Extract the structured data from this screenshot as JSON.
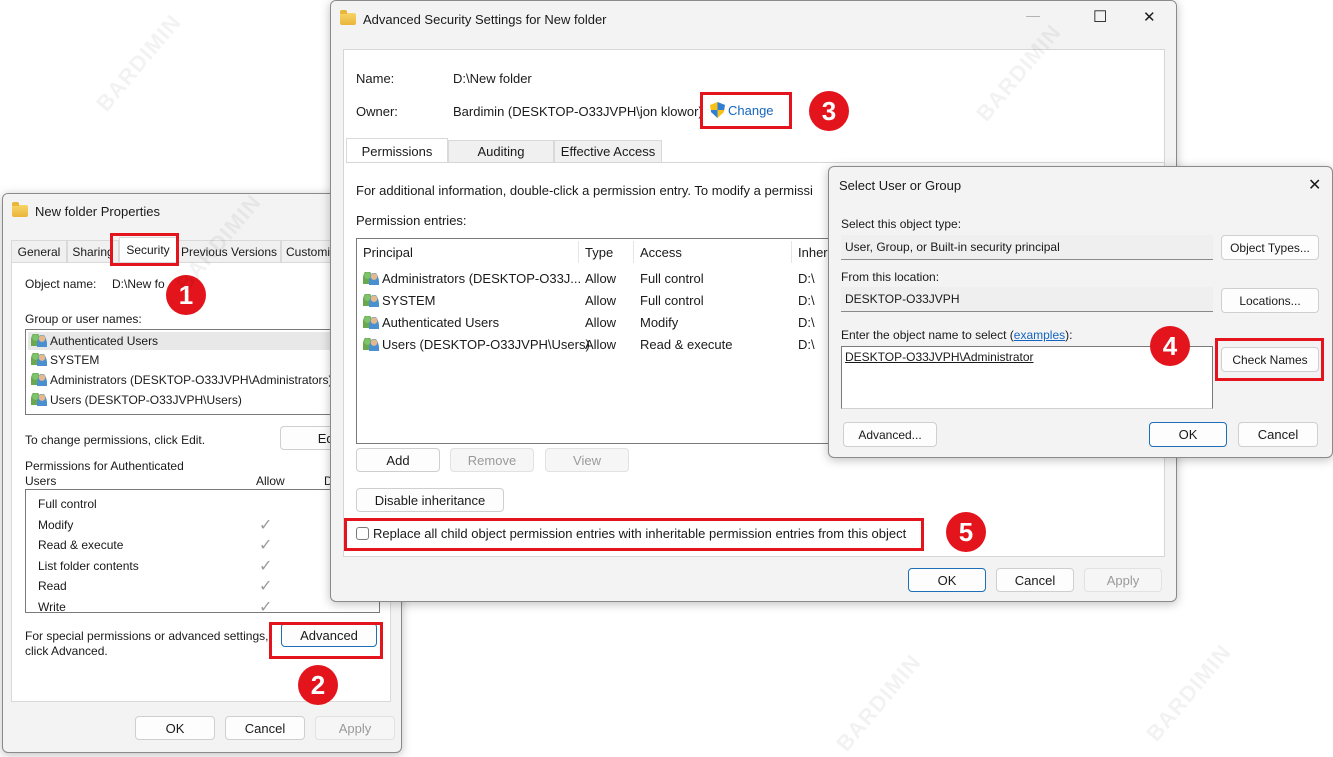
{
  "watermark": "BARDIMIN",
  "properties": {
    "title": "New folder Properties",
    "tabs": [
      "General",
      "Sharing",
      "Security",
      "Previous Versions",
      "Customiz"
    ],
    "active_tab": "Security",
    "object_name_label": "Object name:",
    "object_name_value": "D:\\New fo",
    "group_label": "Group or user names:",
    "groups": [
      "Authenticated Users",
      "SYSTEM",
      "Administrators (DESKTOP-O33JVPH\\Administrators)",
      "Users (DESKTOP-O33JVPH\\Users)"
    ],
    "change_hint": "To change permissions, click Edit.",
    "edit_label": "Edit...",
    "perm_for_label_line1": "Permissions for Authenticated",
    "perm_for_label_line2": "Users",
    "allow_header": "Allow",
    "deny_header": "Deny",
    "permissions": [
      {
        "name": "Full control",
        "allow": false
      },
      {
        "name": "Modify",
        "allow": true
      },
      {
        "name": "Read & execute",
        "allow": true
      },
      {
        "name": "List folder contents",
        "allow": true
      },
      {
        "name": "Read",
        "allow": true
      },
      {
        "name": "Write",
        "allow": true
      }
    ],
    "check_glyph": "✓",
    "special_hint_line1": "For special permissions or advanced settings,",
    "special_hint_line2": "click Advanced.",
    "advanced_label": "Advanced",
    "ok_label": "OK",
    "cancel_label": "Cancel",
    "apply_label": "Apply"
  },
  "advanced": {
    "title": "Advanced Security Settings for New folder",
    "minimize_glyph": "—",
    "maximize_glyph": "☐",
    "close_glyph": "✕",
    "name_label": "Name:",
    "name_value": "D:\\New folder",
    "owner_label": "Owner:",
    "owner_value": "Bardimin (DESKTOP-O33JVPH\\jon klowor)",
    "change_label": "Change",
    "tabs": [
      "Permissions",
      "Auditing",
      "Effective Access"
    ],
    "active_tab": "Permissions",
    "info_text": "For additional information, double-click a permission entry. To modify a permissi",
    "entries_label": "Permission entries:",
    "columns": [
      "Principal",
      "Type",
      "Access",
      "Inheri"
    ],
    "entries": [
      {
        "principal": "Administrators (DESKTOP-O33J...",
        "type": "Allow",
        "access": "Full control",
        "inherited": "D:\\"
      },
      {
        "principal": "SYSTEM",
        "type": "Allow",
        "access": "Full control",
        "inherited": "D:\\"
      },
      {
        "principal": "Authenticated Users",
        "type": "Allow",
        "access": "Modify",
        "inherited": "D:\\"
      },
      {
        "principal": "Users (DESKTOP-O33JVPH\\Users)",
        "type": "Allow",
        "access": "Read & execute",
        "inherited": "D:\\"
      }
    ],
    "add_label": "Add",
    "remove_label": "Remove",
    "view_label": "View",
    "disable_inheritance_label": "Disable inheritance",
    "replace_label": "Replace all child object permission entries with inheritable permission entries from this object",
    "replace_checked": false,
    "ok_label": "OK",
    "cancel_label": "Cancel",
    "apply_label": "Apply"
  },
  "select_user": {
    "title": "Select User or Group",
    "close_glyph": "✕",
    "object_type_label": "Select this object type:",
    "object_type_value": "User, Group, or Built-in security principal",
    "object_types_label": "Object Types...",
    "location_label": "From this location:",
    "location_value": "DESKTOP-O33JVPH",
    "locations_label": "Locations...",
    "enter_label_prefix": "Enter the object name to select (",
    "examples_link": "examples",
    "enter_label_suffix": "):",
    "object_name_value": "DESKTOP-O33JVPH\\Administrator",
    "check_names_label": "Check Names",
    "advanced_label": "Advanced...",
    "ok_label": "OK",
    "cancel_label": "Cancel"
  },
  "steps": [
    "1",
    "2",
    "3",
    "4",
    "5"
  ],
  "colors": {
    "highlight": "#e3141b",
    "link": "#1565c0"
  }
}
